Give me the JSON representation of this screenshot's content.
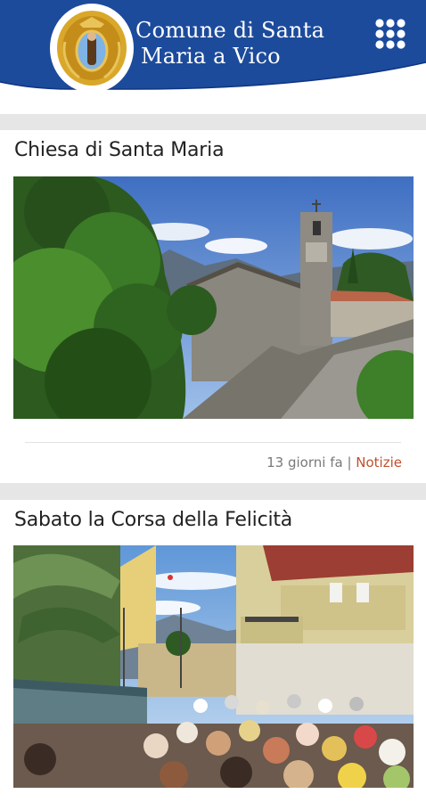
{
  "header": {
    "title_line1": "Comune di Santa",
    "title_line2": "Maria a Vico",
    "brand_color": "#1c4b9c",
    "menu_icon": "grid-menu-icon",
    "logo_icon": "coat-of-arms-logo"
  },
  "news": [
    {
      "title": "Chiesa di Santa Maria",
      "image": "stone-church-with-bell-tower-photo",
      "time_ago": "13 giorni fa",
      "separator": " | ",
      "category": "Notizie",
      "category_color": "#c0502e"
    },
    {
      "title": "Sabato la Corsa della Felicità",
      "image": "crowd-in-street-photo"
    }
  ]
}
